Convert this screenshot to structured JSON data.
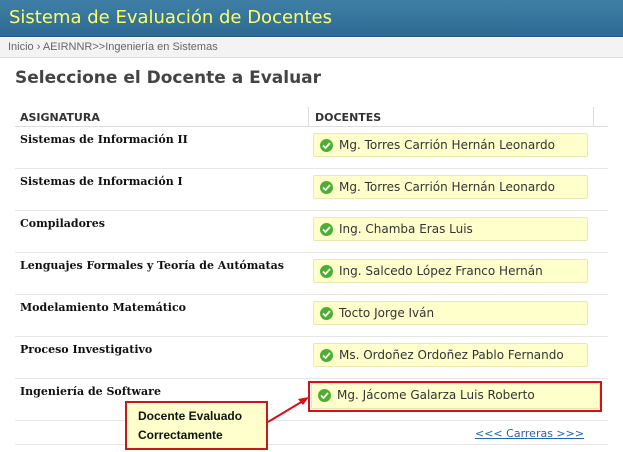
{
  "header": {
    "title": "Sistema de Evaluación de Docentes"
  },
  "breadcrumb": {
    "text": "Inicio › AEIRNNR>>Ingeniería en Sistemas"
  },
  "page": {
    "title": "Seleccione el Docente a Evaluar"
  },
  "table": {
    "columns": [
      "ASIGNATURA",
      "DOCENTES"
    ],
    "rows": [
      {
        "asignatura": "Sistemas de Información II",
        "docente": "Mg. Torres Carrión Hernán Leonardo"
      },
      {
        "asignatura": "Sistemas de Información I",
        "docente": "Mg. Torres Carrión Hernán Leonardo"
      },
      {
        "asignatura": "Compiladores",
        "docente": "Ing. Chamba Eras Luis"
      },
      {
        "asignatura": "Lenguajes Formales y Teoría de Autómatas",
        "docente": "Ing. Salcedo López Franco Hernán"
      },
      {
        "asignatura": "Modelamiento Matemático",
        "docente": "Tocto Jorge Iván"
      },
      {
        "asignatura": "Proceso Investigativo",
        "docente": "Ms. Ordoñez Ordoñez Pablo Fernando"
      },
      {
        "asignatura": "Ingeniería de Software",
        "docente": "Mg. Jácome Galarza Luis Roberto"
      }
    ]
  },
  "footer": {
    "link": "<<< Carreras >>>"
  },
  "callout": {
    "line1": "Docente Evaluado",
    "line2": "Correctamente"
  },
  "colors": {
    "header_bg": "#2e6a93",
    "title_text": "#ffff66",
    "cell_bg": "#ffffcc",
    "check": "#4caf33",
    "highlight": "#d4111b"
  },
  "icons": {
    "status": "check-circle-icon"
  }
}
